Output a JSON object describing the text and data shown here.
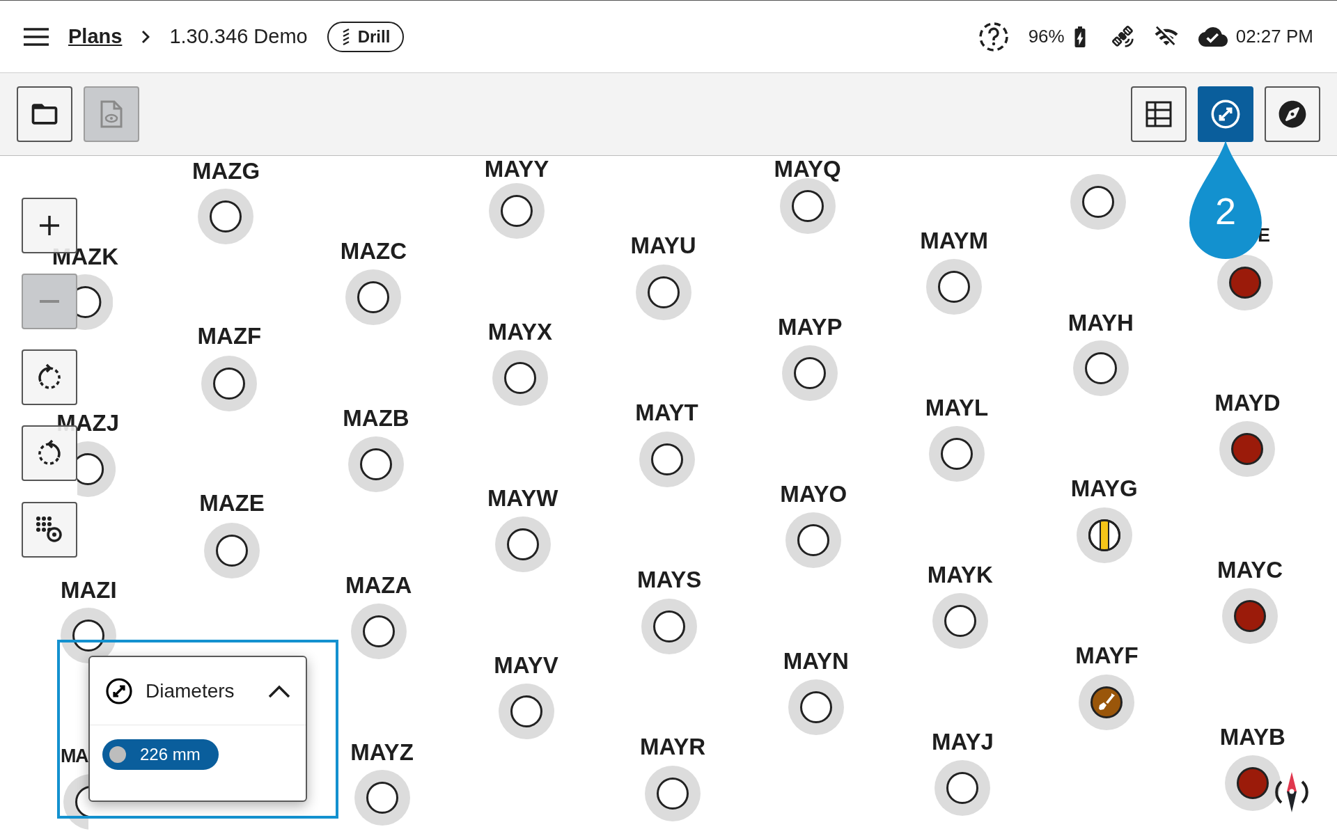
{
  "breadcrumb": {
    "link": "Plans",
    "current": "1.30.346 Demo"
  },
  "mode_chip": "Drill",
  "status": {
    "battery": "96%",
    "time": "02:27 PM"
  },
  "toolbar": {
    "left": [
      {
        "kind": "open",
        "disabled": false
      },
      {
        "kind": "preview",
        "disabled": true
      }
    ],
    "right": [
      {
        "kind": "table",
        "selected": false
      },
      {
        "kind": "diameter",
        "selected": true
      },
      {
        "kind": "compass",
        "selected": false
      }
    ]
  },
  "zoom_controls": [
    {
      "kind": "zoom-in",
      "disabled": false
    },
    {
      "kind": "zoom-out",
      "disabled": true
    },
    {
      "kind": "rotate-cw",
      "disabled": false
    },
    {
      "kind": "rotate-ccw",
      "disabled": false
    },
    {
      "kind": "locate",
      "disabled": false
    }
  ],
  "step_marker": "2",
  "holes": [
    {
      "label": "MAZK",
      "kind": "open"
    },
    {
      "label": "MAZJ",
      "kind": "open"
    },
    {
      "label": "MAZI",
      "kind": "open"
    },
    {
      "label": "MA",
      "kind": "open"
    },
    {
      "label": "MAZG",
      "kind": "open"
    },
    {
      "label": "MAZF",
      "kind": "open"
    },
    {
      "label": "MAZE",
      "kind": "open"
    },
    {
      "label": "MAZC",
      "kind": "open"
    },
    {
      "label": "MAZB",
      "kind": "open"
    },
    {
      "label": "MAZA",
      "kind": "open"
    },
    {
      "label": "MAYZ",
      "kind": "open"
    },
    {
      "label": "MAYY",
      "kind": "open"
    },
    {
      "label": "MAYX",
      "kind": "open"
    },
    {
      "label": "MAYW",
      "kind": "open"
    },
    {
      "label": "MAYV",
      "kind": "open"
    },
    {
      "label": "MAYU",
      "kind": "open"
    },
    {
      "label": "MAYT",
      "kind": "open"
    },
    {
      "label": "MAYS",
      "kind": "open"
    },
    {
      "label": "MAYR",
      "kind": "open"
    },
    {
      "label": "MAYQ",
      "kind": "open"
    },
    {
      "label": "MAYP",
      "kind": "open"
    },
    {
      "label": "MAYO",
      "kind": "open"
    },
    {
      "label": "MAYN",
      "kind": "open"
    },
    {
      "label": "MAYM",
      "kind": "open"
    },
    {
      "label": "MAYL",
      "kind": "open"
    },
    {
      "label": "MAYK",
      "kind": "open"
    },
    {
      "label": "MAYJ",
      "kind": "open"
    },
    {
      "kind": "open"
    },
    {
      "label": "MAYH",
      "kind": "open"
    },
    {
      "label": "MAYG",
      "kind": "partial"
    },
    {
      "label": "MAYF",
      "kind": "dig"
    },
    {
      "label": "E",
      "kind": "drilled"
    },
    {
      "label": "MAYD",
      "kind": "drilled"
    },
    {
      "label": "MAYC",
      "kind": "drilled"
    },
    {
      "label": "MAYB",
      "kind": "drilled"
    }
  ],
  "legend": {
    "title": "Diameters",
    "expanded": true,
    "items": [
      {
        "label": "226 mm",
        "color": "#bdbdbd"
      }
    ]
  }
}
